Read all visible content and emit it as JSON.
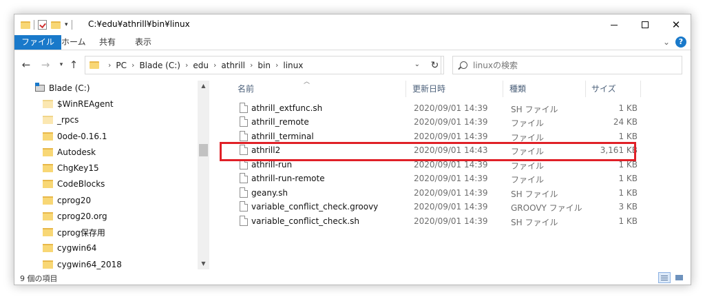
{
  "window": {
    "title": "C:¥edu¥athrill¥bin¥linux",
    "controls": {
      "minimize": "—",
      "maximize": "☐",
      "close": "✕"
    }
  },
  "ribbon": {
    "tabs": [
      {
        "label": "ファイル",
        "active": true
      },
      {
        "label": "ホーム",
        "active": false
      },
      {
        "label": "共有",
        "active": false
      },
      {
        "label": "表示",
        "active": false
      }
    ],
    "help_label": "?"
  },
  "address": {
    "crumbs": [
      "PC",
      "Blade (C:)",
      "edu",
      "athrill",
      "bin",
      "linux"
    ],
    "search_placeholder": "linuxの検索"
  },
  "nav_pane": {
    "items": [
      {
        "label": "Blade (C:)",
        "icon": "drive-icon"
      },
      {
        "label": "$WinREAgent",
        "icon": "folder-icon"
      },
      {
        "label": "_rpcs",
        "icon": "folder-pale-icon"
      },
      {
        "label": "0ode-0.16.1",
        "icon": "folder-icon"
      },
      {
        "label": "Autodesk",
        "icon": "folder-icon"
      },
      {
        "label": "ChgKey15",
        "icon": "folder-icon"
      },
      {
        "label": "CodeBlocks",
        "icon": "folder-icon"
      },
      {
        "label": "cprog20",
        "icon": "folder-icon"
      },
      {
        "label": "cprog20.org",
        "icon": "folder-icon"
      },
      {
        "label": "cprog保存用",
        "icon": "folder-icon"
      },
      {
        "label": "cygwin64",
        "icon": "folder-icon"
      },
      {
        "label": "cygwin64_2018",
        "icon": "folder-icon"
      }
    ]
  },
  "file_list": {
    "columns": {
      "name": "名前",
      "date": "更新日時",
      "type": "種類",
      "size": "サイズ"
    },
    "rows": [
      {
        "name": "athrill_extfunc.sh",
        "date": "2020/09/01 14:39",
        "type": "SH ファイル",
        "size": "1 KB"
      },
      {
        "name": "athrill_remote",
        "date": "2020/09/01 14:39",
        "type": "ファイル",
        "size": "24 KB"
      },
      {
        "name": "athrill_terminal",
        "date": "2020/09/01 14:39",
        "type": "ファイル",
        "size": "1 KB"
      },
      {
        "name": "athrill2",
        "date": "2020/09/01 14:43",
        "type": "ファイル",
        "size": "3,161 KB"
      },
      {
        "name": "athrill-run",
        "date": "2020/09/01 14:39",
        "type": "ファイル",
        "size": "1 KB"
      },
      {
        "name": "athrill-run-remote",
        "date": "2020/09/01 14:39",
        "type": "ファイル",
        "size": "1 KB"
      },
      {
        "name": "geany.sh",
        "date": "2020/09/01 14:39",
        "type": "SH ファイル",
        "size": "1 KB"
      },
      {
        "name": "variable_conflict_check.groovy",
        "date": "2020/09/01 14:39",
        "type": "GROOVY ファイル",
        "size": "3 KB"
      },
      {
        "name": "variable_conflict_check.sh",
        "date": "2020/09/01 14:39",
        "type": "SH ファイル",
        "size": "1 KB"
      }
    ],
    "highlight_color": "#e02027"
  },
  "status": {
    "item_count": "9 個の項目"
  },
  "colors": {
    "accent": "#1979ca",
    "highlight": "#e02027"
  }
}
